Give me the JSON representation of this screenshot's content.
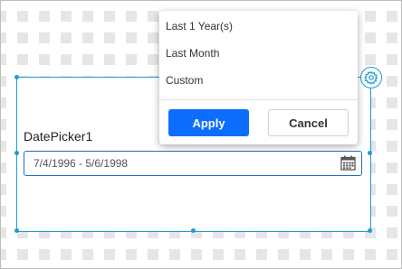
{
  "datepicker": {
    "label": "DatePicker1",
    "value": "7/4/1996 - 5/6/1998",
    "icon": "calendar-icon"
  },
  "settings": {
    "icon": "gear-icon"
  },
  "popup": {
    "items": [
      {
        "label": "Last 1 Year(s)"
      },
      {
        "label": "Last Month"
      },
      {
        "label": "Custom"
      }
    ],
    "apply_label": "Apply",
    "cancel_label": "Cancel"
  },
  "colors": {
    "accent": "#1f9ad6",
    "apply": "#0d6efd",
    "input_border": "#1f6fbf"
  }
}
